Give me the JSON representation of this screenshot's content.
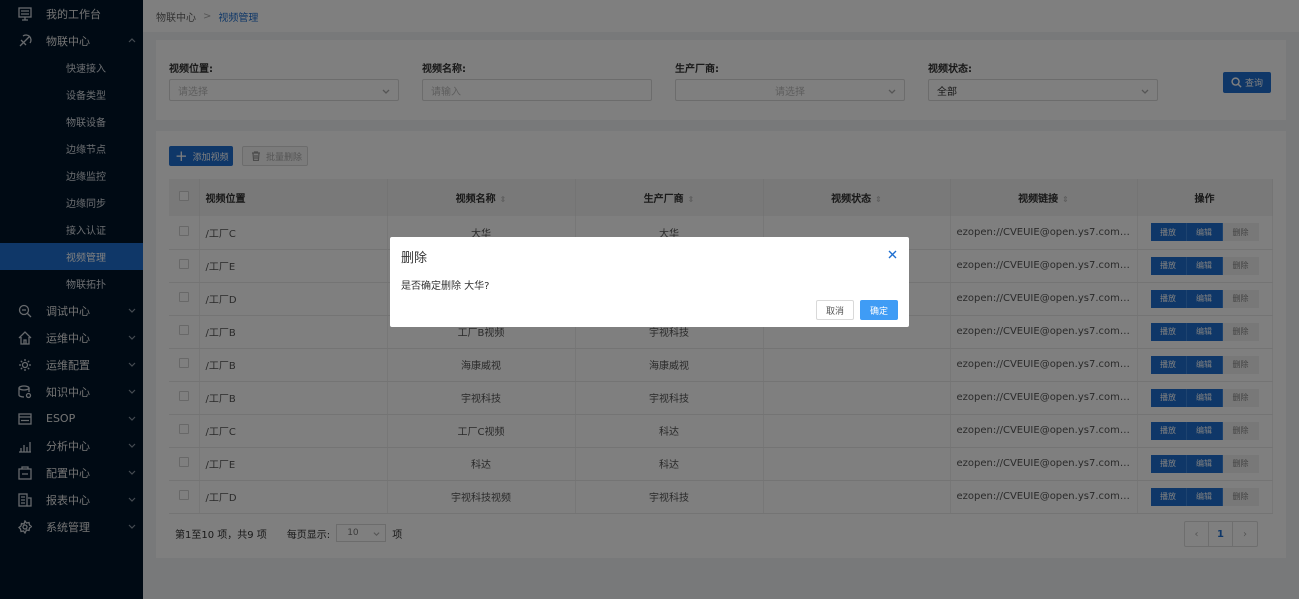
{
  "sidebar": {
    "items": [
      {
        "label": "我的工作台",
        "icon": "monitor-icon",
        "chev": false
      },
      {
        "label": "物联中心",
        "icon": "iot-icon",
        "chev": "up"
      }
    ],
    "sub_items": [
      "快速接入",
      "设备类型",
      "物联设备",
      "边缘节点",
      "边缘监控",
      "边缘同步",
      "接入认证",
      "视频管理",
      "物联拓扑"
    ],
    "active_sub": "视频管理",
    "bottom_items": [
      {
        "label": "调试中心",
        "icon": "debug-icon"
      },
      {
        "label": "运维中心",
        "icon": "house-icon"
      },
      {
        "label": "运维配置",
        "icon": "gear-icon"
      },
      {
        "label": "知识中心",
        "icon": "database-icon"
      },
      {
        "label": "ESOP",
        "icon": "esop-icon"
      },
      {
        "label": "分析中心",
        "icon": "analysis-icon"
      },
      {
        "label": "配置中心",
        "icon": "config-icon"
      },
      {
        "label": "报表中心",
        "icon": "report-icon"
      },
      {
        "label": "系统管理",
        "icon": "settings-icon"
      }
    ]
  },
  "breadcrumb": {
    "parent": "物联中心",
    "current": "视频管理"
  },
  "filters": {
    "location": {
      "label": "视频位置:",
      "placeholder": "请选择"
    },
    "name": {
      "label": "视频名称:",
      "placeholder": "请输入"
    },
    "vendor": {
      "label": "生产厂商:",
      "placeholder": "请选择"
    },
    "status": {
      "label": "视频状态:",
      "value": "全部"
    },
    "search_label": "查询"
  },
  "toolbar": {
    "add_label": "添加视频",
    "batch_delete_label": "批量删除"
  },
  "table": {
    "headers": [
      "视频位置",
      "视频名称",
      "生产厂商",
      "视频状态",
      "视频链接",
      "操作"
    ],
    "rows": [
      {
        "location": "/工厂C",
        "name": "大华",
        "vendor": "大华",
        "status": "",
        "link": "ezopen://CVEUIE@open.ys7.com/D50..."
      },
      {
        "location": "/工厂E",
        "name": "",
        "vendor": "",
        "status": "",
        "link": "ezopen://CVEUIE@open.ys7.com/D50..."
      },
      {
        "location": "/工厂D",
        "name": "",
        "vendor": "",
        "status": "",
        "link": "ezopen://CVEUIE@open.ys7.com/D50..."
      },
      {
        "location": "/工厂B",
        "name": "工厂B视频",
        "vendor": "宇视科技",
        "status": "",
        "link": "ezopen://CVEUIE@open.ys7.com/D50..."
      },
      {
        "location": "/工厂B",
        "name": "海康威视",
        "vendor": "海康威视",
        "status": "",
        "link": "ezopen://CVEUIE@open.ys7.com/D50..."
      },
      {
        "location": "/工厂B",
        "name": "宇视科技",
        "vendor": "宇视科技",
        "status": "",
        "link": "ezopen://CVEUIE@open.ys7.com/D50..."
      },
      {
        "location": "/工厂C",
        "name": "工厂C视频",
        "vendor": "科达",
        "status": "",
        "link": "ezopen://CVEUIE@open.ys7.com/D50..."
      },
      {
        "location": "/工厂E",
        "name": "科达",
        "vendor": "科达",
        "status": "",
        "link": "ezopen://CVEUIE@open.ys7.com/D50..."
      },
      {
        "location": "/工厂D",
        "name": "宇视科技视频",
        "vendor": "宇视科技",
        "status": "",
        "link": "ezopen://CVEUIE@open.ys7.com/D50..."
      }
    ],
    "op_labels": {
      "play": "播放",
      "edit": "编辑",
      "delete": "删除"
    }
  },
  "pagination": {
    "summary": "第1至10 项，共9 项",
    "per_page_label": "每页显示:",
    "per_page_value": "10",
    "unit": "项",
    "current_page": "1"
  },
  "dialog": {
    "title": "删除",
    "message": "是否确定删除 大华?",
    "cancel_label": "取消",
    "ok_label": "确定"
  },
  "colors": {
    "primary": "#1e6fd0",
    "sidebar_bg": "#001529",
    "confirm": "#3f9cf5"
  }
}
